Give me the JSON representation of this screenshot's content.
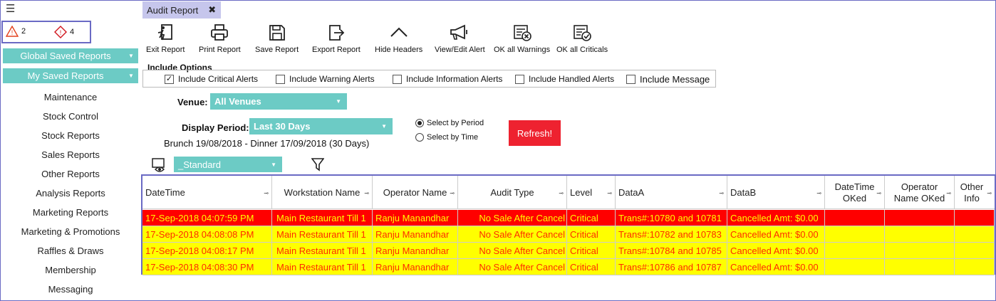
{
  "sidebar": {
    "menu_icon": "hamburger-icon",
    "warning_count": "2",
    "critical_count": "4",
    "global_saved_reports": "Global Saved Reports",
    "my_saved_reports": "My Saved Reports",
    "items": [
      {
        "label": "Maintenance"
      },
      {
        "label": "Stock Control"
      },
      {
        "label": "Stock Reports"
      },
      {
        "label": "Sales Reports"
      },
      {
        "label": "Other Reports"
      },
      {
        "label": "Analysis Reports"
      },
      {
        "label": "Marketing Reports"
      },
      {
        "label": "Marketing & Promotions"
      },
      {
        "label": "Raffles & Draws"
      },
      {
        "label": "Membership"
      },
      {
        "label": "Messaging"
      }
    ]
  },
  "tab": {
    "label": "Audit Report",
    "close": "✖"
  },
  "toolbar": {
    "exit": "Exit Report",
    "print": "Print Report",
    "save": "Save Report",
    "export": "Export Report",
    "hide": "Hide Headers",
    "view_edit": "View/Edit Alert",
    "ok_warnings": "OK all Warnings",
    "ok_criticals": "OK all Criticals"
  },
  "include": {
    "title": "Include Options",
    "options": [
      {
        "label": "Include Critical Alerts",
        "checked": true
      },
      {
        "label": "Include Warning Alerts",
        "checked": false
      },
      {
        "label": "Include Information Alerts",
        "checked": false
      },
      {
        "label": "Include Handled Alerts",
        "checked": false
      },
      {
        "label": "Include  Message",
        "checked": false
      }
    ]
  },
  "filters": {
    "venue_label": "Venue:",
    "venue_value": "All Venues",
    "period_label": "Display Period:",
    "period_value": "Last 30 Days",
    "period_text": "Brunch 19/08/2018 - Dinner 17/09/2018 (30 Days)",
    "radio_period": "Select by Period",
    "radio_time": "Select  by Time",
    "refresh": "Refresh!",
    "layout_value": "_Standard"
  },
  "colors": {
    "teal": "#6ccbc5",
    "critical_row": "#ff0000",
    "warning_row": "#ffff00",
    "row_text_yellow": "#ff2a00",
    "row_text_red": "#ffff00",
    "refresh": "#ee2230"
  },
  "grid": {
    "headers": [
      "DateTime",
      "Workstation Name",
      "Operator Name",
      "Audit Type",
      "Level",
      "DataA",
      "DataB",
      "DateTime OKed",
      "Operator Name OKed",
      "Other Info"
    ],
    "rows": [
      {
        "style": "red",
        "cells": [
          "17-Sep-2018 04:07:59 PM",
          "Main Restaurant Till 1",
          "Ranju  Manandhar",
          "No Sale After Cancel",
          "Critical",
          "Trans#:10780 and 10781",
          "Cancelled Amt: $0.00",
          "",
          "",
          ""
        ]
      },
      {
        "style": "yellow",
        "cells": [
          "17-Sep-2018 04:08:08 PM",
          "Main Restaurant Till 1",
          "Ranju  Manandhar",
          "No Sale After Cancel",
          "Critical",
          "Trans#:10782 and 10783",
          "Cancelled Amt: $0.00",
          "",
          "",
          ""
        ]
      },
      {
        "style": "yellow",
        "cells": [
          "17-Sep-2018 04:08:17 PM",
          "Main Restaurant Till 1",
          "Ranju  Manandhar",
          "No Sale After Cancel",
          "Critical",
          "Trans#:10784 and 10785",
          "Cancelled Amt: $0.00",
          "",
          "",
          ""
        ]
      },
      {
        "style": "yellow",
        "cells": [
          "17-Sep-2018 04:08:30 PM",
          "Main Restaurant Till 1",
          "Ranju  Manandhar",
          "No Sale After Cancel",
          "Critical",
          "Trans#:10786 and 10787",
          "Cancelled Amt: $0.00",
          "",
          "",
          ""
        ]
      }
    ]
  }
}
